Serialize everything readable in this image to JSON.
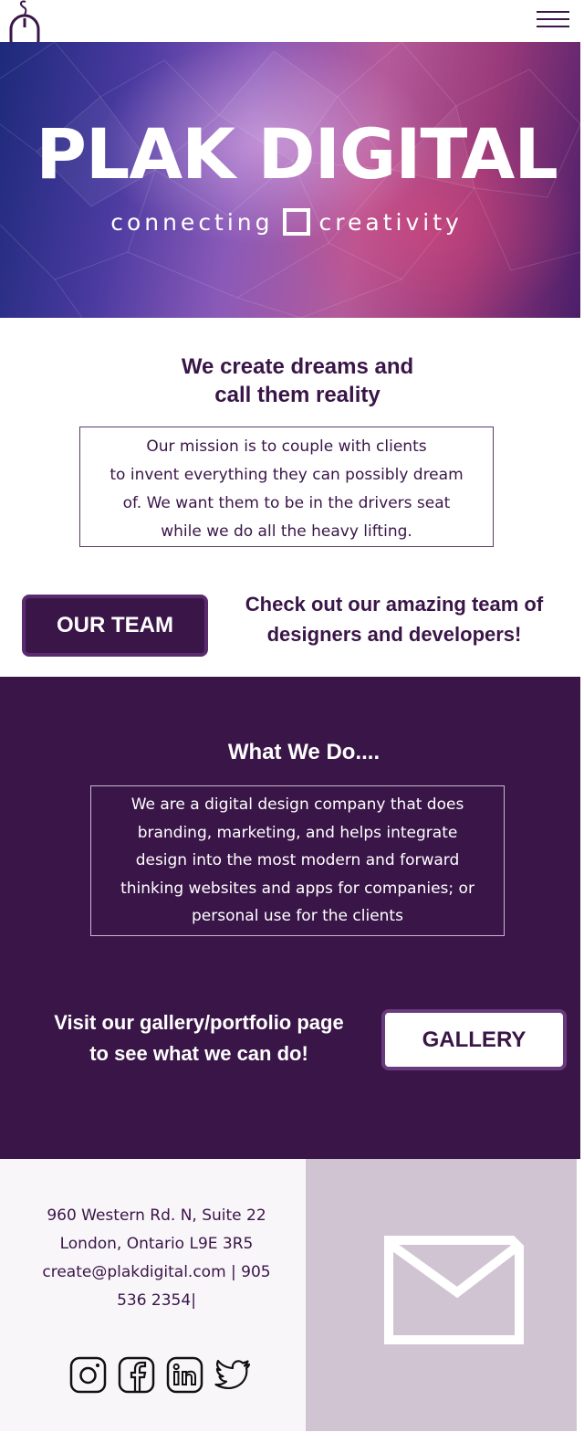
{
  "nav": {
    "logo_icon": "mouse-icon",
    "menu_icon": "hamburger-menu-icon"
  },
  "hero": {
    "title": "PLAK DIGITAL",
    "tagline_left": "connecting",
    "tagline_right": "creativity"
  },
  "intro": {
    "headline_line1": "We create dreams and",
    "headline_line2": "call them reality",
    "mission_lines": [
      "Our mission is to couple with clients",
      "to invent everything they can possibly dream",
      "of. We want them to be in the drivers seat",
      "while we do all the heavy lifting."
    ]
  },
  "team": {
    "button_label": "OUR TEAM",
    "text_line1": "Check out our amazing team of",
    "text_line2": "designers and developers!"
  },
  "what_we_do": {
    "title": "What We Do....",
    "lines": [
      "We are a digital design company that does",
      "branding, marketing, and helps integrate",
      "design into the most modern and forward",
      "thinking websites and apps for companies; or",
      "personal use for the clients"
    ]
  },
  "gallery": {
    "text_line1": "Visit our gallery/portfolio page",
    "text_line2": "to see what we can do!",
    "button_label": "GALLERY"
  },
  "footer": {
    "address_lines": [
      "960 Western Rd. N, Suite 22",
      "London, Ontario L9E 3R5",
      "create@plakdigital.com | 905",
      "536 2354|"
    ],
    "social_icons": [
      "instagram-icon",
      "facebook-icon",
      "linkedin-icon",
      "twitter-icon"
    ],
    "contact_icon": "mail-icon"
  },
  "colors": {
    "brand_purple": "#3a1548",
    "footer_panel": "#d0c4d2",
    "footer_bg": "#f9f6fa"
  }
}
